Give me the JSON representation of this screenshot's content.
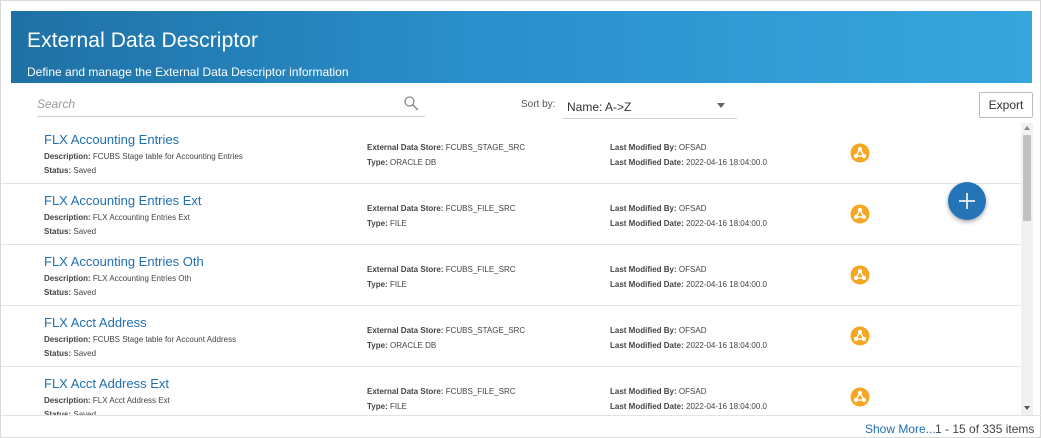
{
  "header": {
    "title": "External Data Descriptor",
    "subtitle": "Define and manage the External Data Descriptor information"
  },
  "search": {
    "placeholder": "Search",
    "icon": "search-icon"
  },
  "sort": {
    "label": "Sort by:",
    "value": "Name: A->Z"
  },
  "toolbar": {
    "export_label": "Export"
  },
  "labels": {
    "description": "Description:",
    "status": "Status:",
    "store": "External Data Store:",
    "type": "Type:",
    "modified_by": "Last Modified By:",
    "modified_date": "Last Modified Date:"
  },
  "rows": [
    {
      "name": "FLX Accounting Entries",
      "description": "FCUBS Stage table for Accounting Entries",
      "status": "Saved",
      "store": "FCUBS_STAGE_SRC",
      "type": "ORACLE DB",
      "modified_by": "OFSAD",
      "modified_date": "2022-04-16 18:04:00.0"
    },
    {
      "name": "FLX Accounting Entries Ext",
      "description": "FLX Accounting Entries Ext",
      "status": "Saved",
      "store": "FCUBS_FILE_SRC",
      "type": "FILE",
      "modified_by": "OFSAD",
      "modified_date": "2022-04-16 18:04:00.0"
    },
    {
      "name": "FLX Accounting Entries Oth",
      "description": "FLX Accounting Entries Oth",
      "status": "Saved",
      "store": "FCUBS_FILE_SRC",
      "type": "FILE",
      "modified_by": "OFSAD",
      "modified_date": "2022-04-16 18:04:00.0"
    },
    {
      "name": "FLX Acct Address",
      "description": "FCUBS Stage table for Account Address",
      "status": "Saved",
      "store": "FCUBS_STAGE_SRC",
      "type": "ORACLE DB",
      "modified_by": "OFSAD",
      "modified_date": "2022-04-16 18:04:00.0"
    },
    {
      "name": "FLX Acct Address Ext",
      "description": "FLX Acct Address Ext",
      "status": "Saved",
      "store": "FCUBS_FILE_SRC",
      "type": "FILE",
      "modified_by": "OFSAD",
      "modified_date": "2022-04-16 18:04:00.0"
    }
  ],
  "row_icon": "share-action-icon",
  "footer": {
    "show_more": "Show More...",
    "count": "1 - 15 of 335 items"
  },
  "colors": {
    "header_start": "#1f71a5",
    "header_end": "#37a6dd",
    "link": "#1f6fb2",
    "action_icon": "#f5a623",
    "fab": "#2574b8"
  }
}
